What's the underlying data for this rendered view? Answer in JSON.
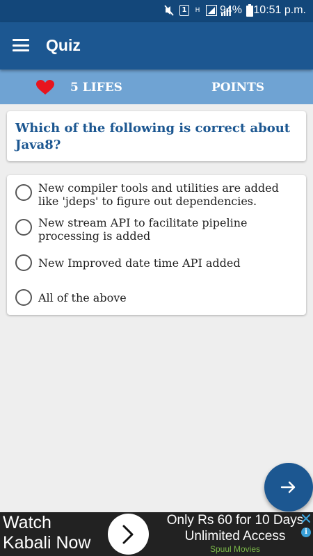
{
  "status_bar": {
    "battery": "94%",
    "time": "10:51 p.m.",
    "sim": "1",
    "network": "H"
  },
  "app_bar": {
    "title": "Quiz",
    "menu_icon": "hamburger-menu-icon"
  },
  "score_bar": {
    "lives_label": "5 LIFES",
    "points_label": "POINTS",
    "heart_icon": "heart-icon",
    "heart_color": "#e8141e"
  },
  "question": {
    "text": "Which of the following is correct about Java8?"
  },
  "options": [
    {
      "text": "New compiler tools and utilities are added like 'jdeps' to figure out dependencies.",
      "selected": false
    },
    {
      "text": "New stream API to facilitate pipeline processing is added",
      "selected": false
    },
    {
      "text": "New Improved date time API added",
      "selected": false
    },
    {
      "text": "All of the above",
      "selected": false
    }
  ],
  "fab": {
    "icon": "arrow-right-icon"
  },
  "ad": {
    "left_line1": "Watch",
    "left_line2": "Kabali Now",
    "right_line1": "Only Rs 60 for 10 Days",
    "right_line2": "Unlimited Access",
    "sponsor": "Spuul Movies",
    "sponsor_color": "#7ab648"
  },
  "colors": {
    "primary": "#1c5791",
    "status_bar": "#13477a",
    "score_bar": "#6fa3d3",
    "background": "#eeeeee"
  }
}
